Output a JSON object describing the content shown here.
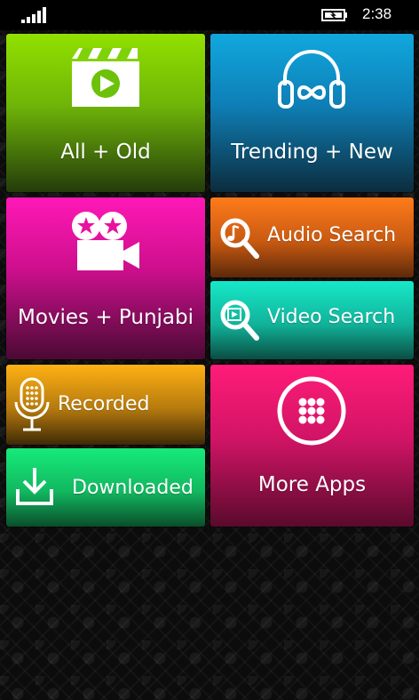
{
  "status_bar": {
    "time": "2:38",
    "signal_icon": "signal-bars-icon",
    "battery_icon": "battery-charging-icon"
  },
  "tiles": {
    "all_old": {
      "label": "All + Old",
      "icon": "clapperboard-play-icon",
      "color": "#7fd10a"
    },
    "trending_new": {
      "label": "Trending + New",
      "icon": "headphones-infinity-icon",
      "color": "#0ea0d6"
    },
    "movies_punjabi": {
      "label": "Movies + Punjabi",
      "icon": "movie-camera-icon",
      "color": "#e8129f"
    },
    "audio_search": {
      "label": "Audio Search",
      "icon": "audio-search-icon",
      "color": "#f06f18"
    },
    "video_search": {
      "label": "Video Search",
      "icon": "video-search-icon",
      "color": "#15d3b4"
    },
    "recorded": {
      "label": "Recorded",
      "icon": "microphone-icon",
      "color": "#f4a414"
    },
    "downloaded": {
      "label": "Downloaded",
      "icon": "download-icon",
      "color": "#14d86c"
    },
    "more_apps": {
      "label": "More Apps",
      "icon": "app-grid-icon",
      "color": "#f0186e"
    }
  }
}
